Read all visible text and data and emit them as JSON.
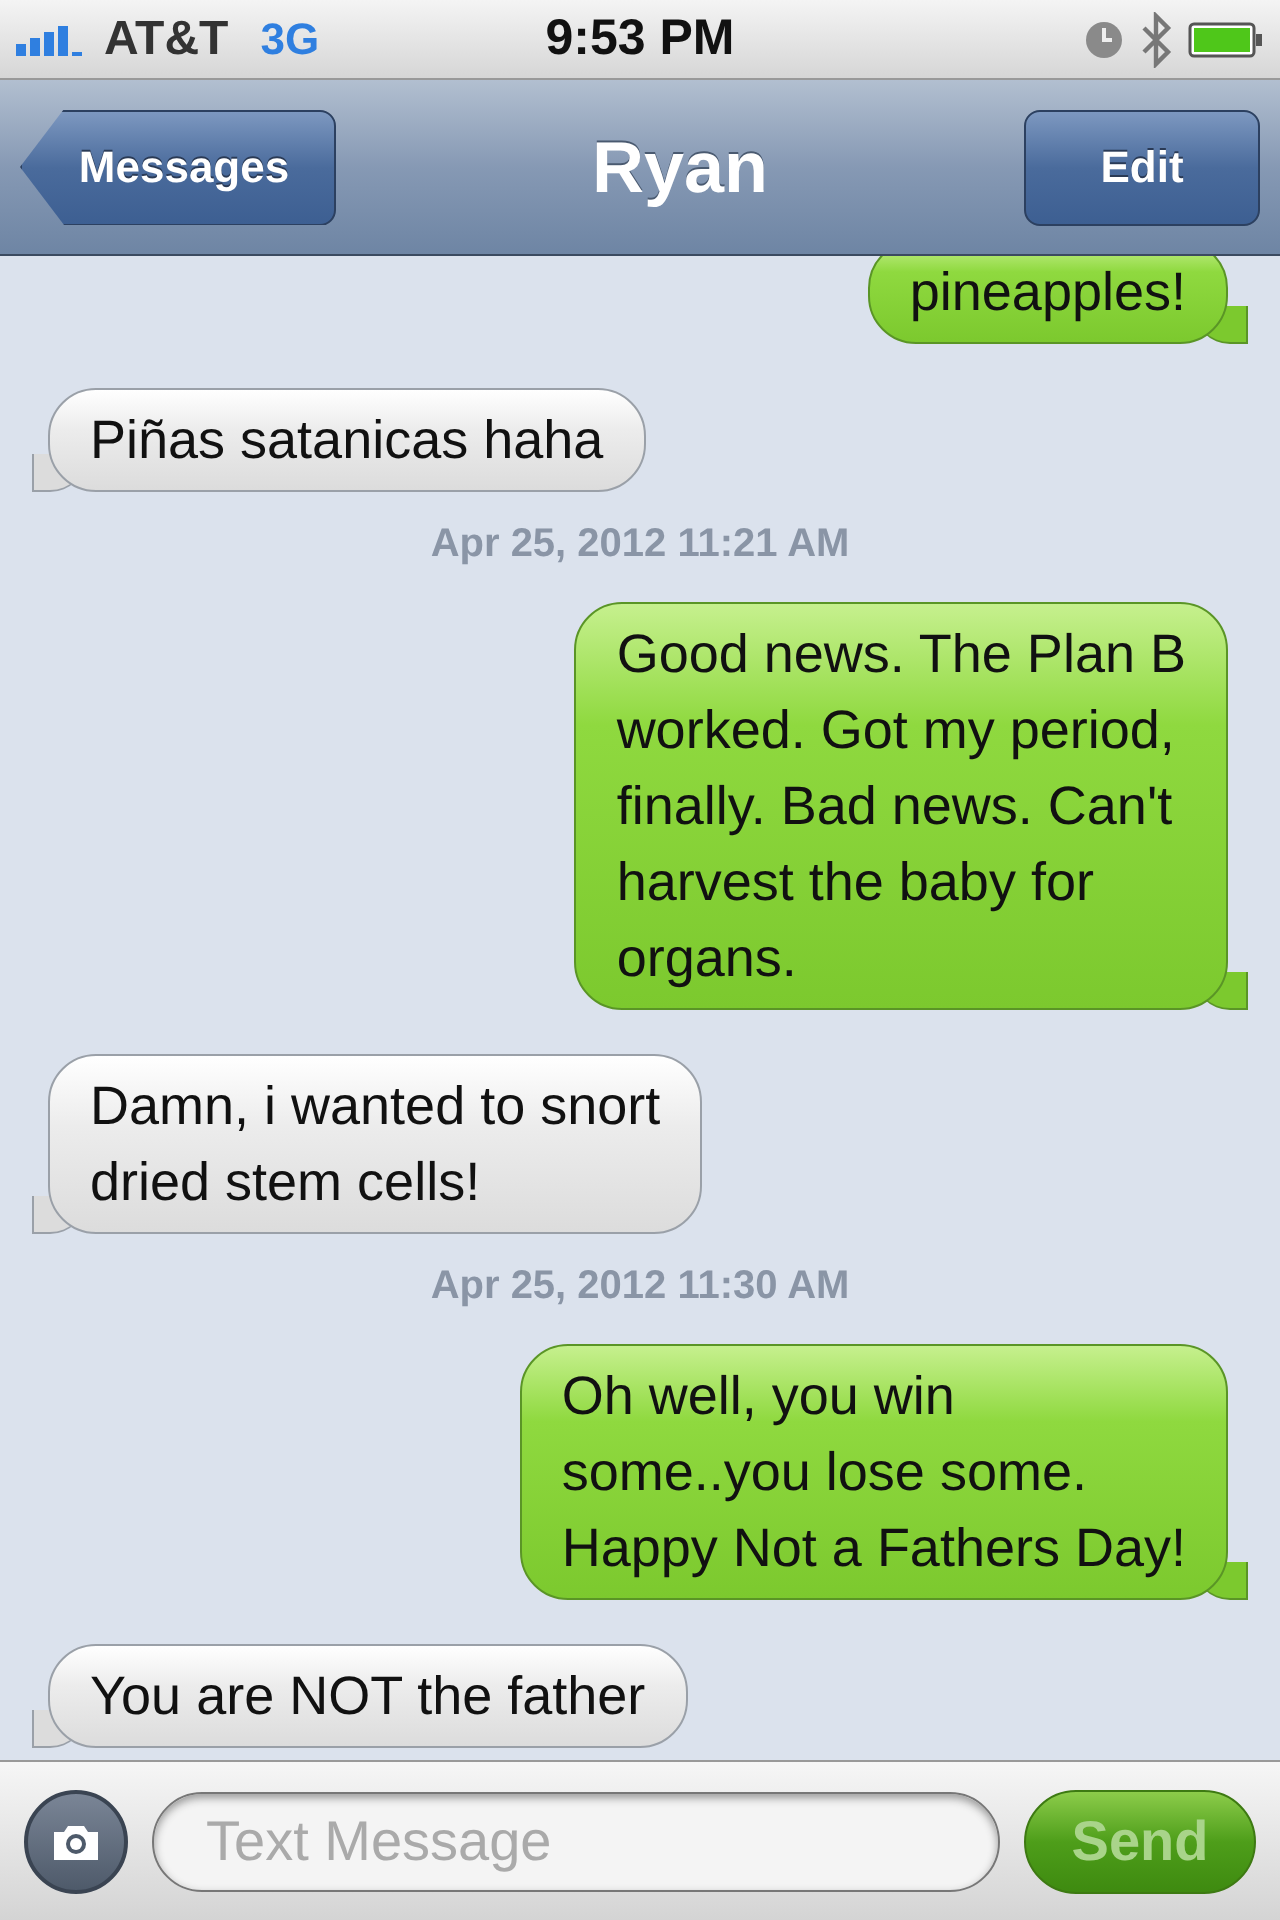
{
  "status_bar": {
    "carrier": "AT&T",
    "network": "3G",
    "time": "9:53 PM"
  },
  "nav": {
    "back": "Messages",
    "title": "Ryan",
    "action": "Edit"
  },
  "messages": [
    {
      "kind": "sent",
      "text": "pineapples!"
    },
    {
      "kind": "received",
      "text": "Piñas satanicas haha"
    },
    {
      "kind": "timestamp",
      "text": "Apr 25, 2012 11:21 AM"
    },
    {
      "kind": "sent",
      "text": "Good news. The Plan B\nworked. Got my period,\nfinally. Bad news. Can't\nharvest the baby for\norgans."
    },
    {
      "kind": "received",
      "text": "Damn, i wanted to snort\ndried stem cells!"
    },
    {
      "kind": "timestamp",
      "text": "Apr 25, 2012 11:30 AM"
    },
    {
      "kind": "sent",
      "text": "Oh well, you win\nsome..you lose some.\nHappy Not a Fathers Day!"
    },
    {
      "kind": "received",
      "text": "You are NOT the father"
    }
  ],
  "composer": {
    "placeholder": "Text Message",
    "send": "Send",
    "send_disabled": true
  }
}
